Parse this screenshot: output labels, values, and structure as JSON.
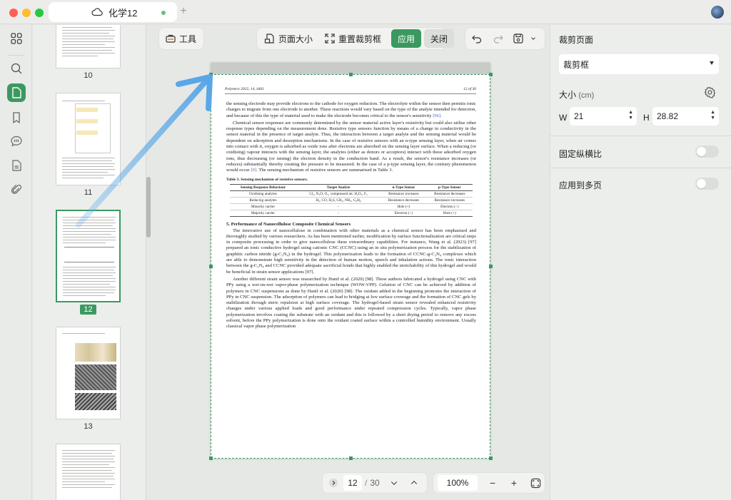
{
  "window": {
    "tab_title": "化学12",
    "add_tab": "+"
  },
  "thumbnails": [
    {
      "label": "10",
      "selected": false
    },
    {
      "label": "11",
      "selected": false
    },
    {
      "label": "12",
      "selected": true
    },
    {
      "label": "13",
      "selected": false
    }
  ],
  "toolbar": {
    "tools_label": "工具",
    "page_size_label": "页面大小",
    "reset_crop_label": "重置裁剪框",
    "apply_label": "应用",
    "close_label": "关闭"
  },
  "document": {
    "header_left": "Polymers 2022, 14, 4461",
    "header_right": "12 of 30",
    "p1": "the sensing electrode may provide electrons to the cathode for oxygen reduction. The electrolyte within the sensor then permits ionic charges to migrate from one electrode to another. These reactions would vary based on the type of the analyte intended for detection, and because of this the type of material used to make the electrode becomes critical to the sensor's sensitivity",
    "p1_cite": "[96].",
    "p2": "Chemical sensor responses are commonly determined by the sensor material active layer's resistivity but could also utilise other response types depending on the measurement done. Resistive type sensors function by means of a change in conductivity in the sensor material in the presence of target analyte. Thus, the interaction between a target analyte and the sensing material would be dependent on adsorption and desorption mechanisms. In the case of resistive sensors with an n-type sensing layer, when air comes into contact with it, oxygen is adsorbed as oxide ions after electrons are absorbed on the sensing layer surface. When a reducing (or oxidising) vapour interacts with the sensing layer, the analytes (either as donors or acceptors) interact with these adsorbed oxygen ions, thus decreasing (or raising) the electron density in the conduction band. As a result, the sensor's resistance increases (or reduces) substantially thereby creating the pressure to be measured. In the case of a p-type sensing layer, the contrary phenomenon would occur",
    "p2_cite": "[9].",
    "p2_tail": "The sensing mechanism of resistive sensors are summarised in Table 3.",
    "table_caption": "Table 3. Sensing mechanism of resistive sensors.",
    "table_headers": [
      "Sensing Response Behaviour",
      "Target Analyte",
      "n-Type Sensor",
      "p-Type Sensor"
    ],
    "table_rows": [
      [
        "Oxidising analytes",
        "Cl₂, N₂O, O₂, compressed air, H₂O₂, F₂",
        "Resistance increases",
        "Resistance decreases"
      ],
      [
        "Reducing analytes",
        "H₂, CO, H₂S, CH₄, NH₃, C₆H₆",
        "Resistance decreases",
        "Resistance increases"
      ],
      [
        "Minority carrier",
        "-",
        "Hole (+)",
        "Electron (−)"
      ],
      [
        "Majority carrier",
        "-",
        "Electron (−)",
        "Hole (+)"
      ]
    ],
    "section_title": "5. Performance of Nanocellulose Composite Chemical Sensors",
    "p3": "The innovative use of nanocellulose in combination with other materials as a chemical sensor has been emphasised and thoroughly studied by various researchers. As has been mentioned earlier, modification by surface functionalization are critical steps in composite processing in order to give nanocellulose these extraordinary capabilities. For instance, Wang et al. (2023) [97] prepared an ionic conductive hydrogel using cationic CNC (CCNC) using an in situ polymerization process for the stabilization of graphitic carbon nitride (g-C₃N₄) in the hydrogel. This polymerization leads to the formation of CCNC-g-C₃N₄ complexes which are able to demonstrate high sensitivity in the detection of human motion, speech and inhalation actions. The ionic interaction between the g-C₃N₄ and CCNC provided adequate sacrificial bonds that highly enabled the stretchability of this hydrogel and would be beneficial in strain sensor applications [97].",
    "p4": "Another different strain sensor was researched by Hanif et al. (2020) [98]. These authors fabricated a hydrogel using CNC with PPy using a wet-on-wet vapor-phase polymerization technique (WOW-VPP). Gelation of CNC can be achieved by addition of polymers in CNC suspensions as done by Hanif et al. (2020) [98]. The oxidant added in the beginning promotes the interaction of PPy in CNC suspension. The adsorption of polymers can lead to bridging at low surface coverage and the formation of CNC gels by stabilization through steric repulsion at high surface coverage. The hydrogel-based strain sensor revealed enhanced resistivity changes under various applied loads and good performance under repeated compression cycles. Typically, vapor phase polymerization involves coating the substrate with an oxidant and this is followed by a short drying period to remove any excess solvent, before the PPy polymerization is done onto the oxidant coated surface within a controlled humidity environment. Usually classical vapor phase polymerization"
  },
  "bottom_nav": {
    "current_page": "12",
    "separator": "/",
    "total_pages": "30",
    "zoom": "100%",
    "zoom_out": "−",
    "zoom_in": "+"
  },
  "right_panel": {
    "title": "裁剪页面",
    "crop_mode": "裁剪框",
    "size_label": "大小",
    "size_unit": "(cm)",
    "w_label": "W",
    "w_value": "21",
    "h_label": "H",
    "h_value": "28.82",
    "lock_ratio_label": "固定纵横比",
    "lock_ratio_on": false,
    "apply_multi_label": "应用到多页",
    "apply_multi_on": false
  },
  "colors": {
    "accent": "#3b9960",
    "arrow": "#5aa7e8"
  }
}
